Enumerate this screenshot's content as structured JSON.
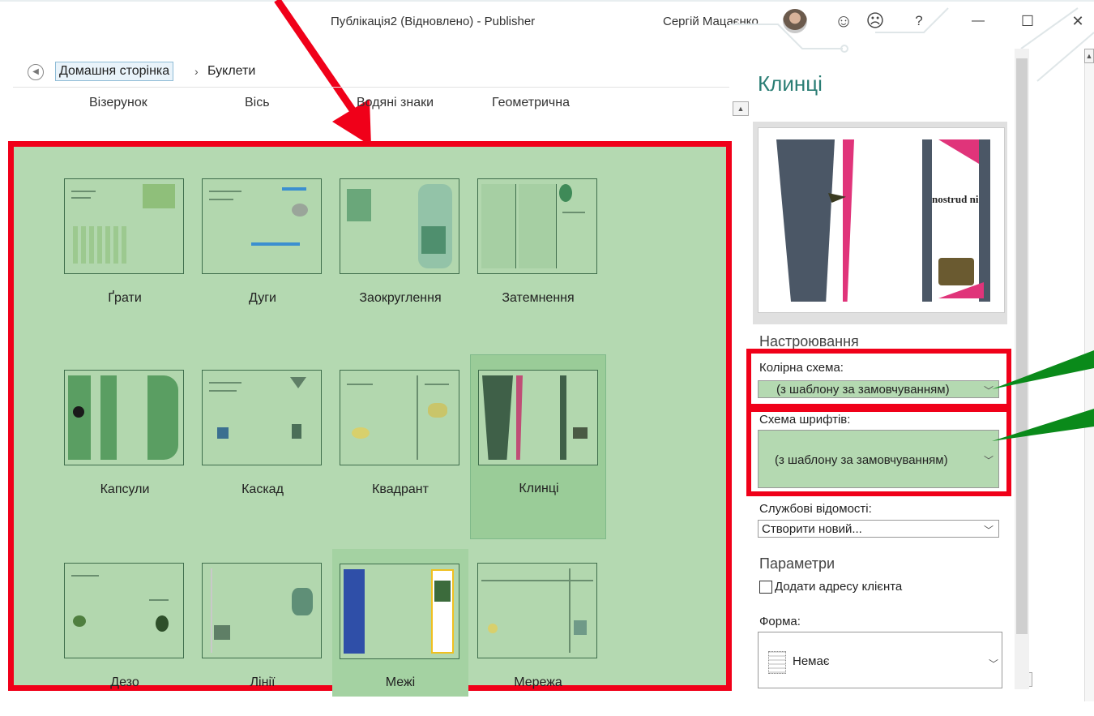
{
  "window": {
    "title": "Публікація2 (Відновлено)  -  Publisher",
    "user": "Сергій Мацаєнко",
    "smile_icon": "☺",
    "frown_icon": "☹",
    "help": "?",
    "minimize": "—",
    "maximize": "☐",
    "close": "✕"
  },
  "breadcrumb": {
    "back_icon": "◀",
    "home": "Домашня сторінка",
    "separator": "›",
    "current": "Буклети"
  },
  "categories": [
    "Візерунок",
    "Вісь",
    "Водяні знаки",
    "Геометрична"
  ],
  "templates": [
    {
      "name": "Ґрати"
    },
    {
      "name": "Дуги"
    },
    {
      "name": "Заокруглення"
    },
    {
      "name": "Затемнення"
    },
    {
      "name": "Капсули"
    },
    {
      "name": "Каскад"
    },
    {
      "name": "Квадрант"
    },
    {
      "name": "Клинці"
    },
    {
      "name": "Дезо"
    },
    {
      "name": "Лінії"
    },
    {
      "name": "Межі"
    },
    {
      "name": "Мережа"
    }
  ],
  "selected_template": "Клинці",
  "panel": {
    "title": "Клинці",
    "preview_text": "nostrud ni",
    "customize_heading": "Настроювання",
    "color_scheme_label": "Колірна схема:",
    "color_scheme_value": "(з шаблону за замовчуванням)",
    "font_scheme_label": "Схема шрифтів:",
    "font_scheme_value": "(з шаблону за замовчуванням)",
    "business_info_label": "Службові відомості:",
    "business_info_value": "Створити новий...",
    "options_heading": "Параметри",
    "add_address_label": "Додати адресу клієнта",
    "form_label": "Форма:",
    "form_value": "Немає"
  },
  "colors": {
    "annotation_red": "#f00019",
    "annotation_green": "#0a8a1a",
    "gallery_green": "#b4d9b1",
    "panel_title_teal": "#2a7d74"
  }
}
